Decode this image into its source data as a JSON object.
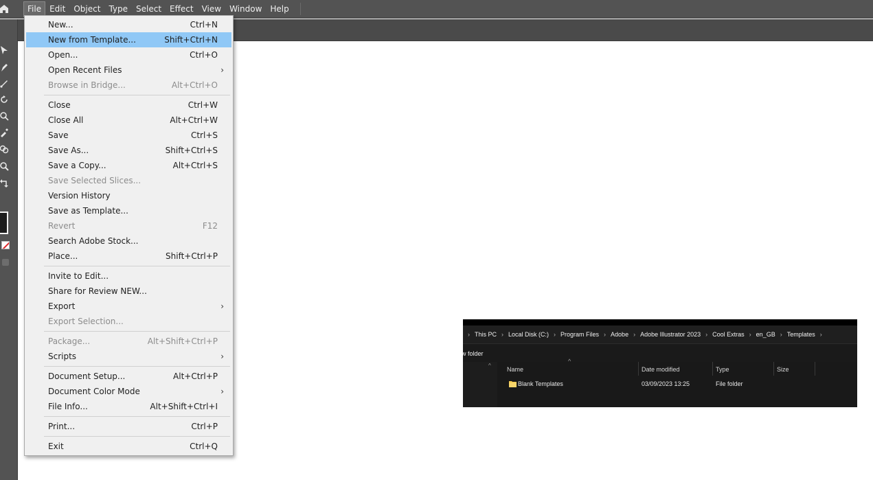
{
  "menubar": {
    "items": [
      "File",
      "Edit",
      "Object",
      "Type",
      "Select",
      "Effect",
      "View",
      "Window",
      "Help"
    ],
    "open_item": "File"
  },
  "file_menu": {
    "highlighted": "New from Template...",
    "items": [
      {
        "label": "New...",
        "shortcut": "Ctrl+N"
      },
      {
        "label": "New from Template...",
        "shortcut": "Shift+Ctrl+N"
      },
      {
        "label": "Open...",
        "shortcut": "Ctrl+O"
      },
      {
        "label": "Open Recent Files",
        "shortcut": "",
        "submenu": true
      },
      {
        "label": "Browse in Bridge...",
        "shortcut": "Alt+Ctrl+O",
        "disabled": true
      },
      {
        "label": "Close",
        "shortcut": "Ctrl+W"
      },
      {
        "label": "Close All",
        "shortcut": "Alt+Ctrl+W"
      },
      {
        "label": "Save",
        "shortcut": "Ctrl+S"
      },
      {
        "label": "Save As...",
        "shortcut": "Shift+Ctrl+S"
      },
      {
        "label": "Save a Copy...",
        "shortcut": "Alt+Ctrl+S"
      },
      {
        "label": "Save Selected Slices...",
        "shortcut": "",
        "disabled": true
      },
      {
        "label": "Version History",
        "shortcut": ""
      },
      {
        "label": "Save as Template...",
        "shortcut": ""
      },
      {
        "label": "Revert",
        "shortcut": "F12",
        "disabled": true
      },
      {
        "label": "Search Adobe Stock...",
        "shortcut": ""
      },
      {
        "label": "Place...",
        "shortcut": "Shift+Ctrl+P"
      },
      {
        "label": "Invite to Edit...",
        "shortcut": ""
      },
      {
        "label": "Share for Review NEW...",
        "shortcut": ""
      },
      {
        "label": "Export",
        "shortcut": "",
        "submenu": true
      },
      {
        "label": "Export Selection...",
        "shortcut": "",
        "disabled": true
      },
      {
        "label": "Package...",
        "shortcut": "Alt+Shift+Ctrl+P",
        "disabled": true
      },
      {
        "label": "Scripts",
        "shortcut": "",
        "submenu": true
      },
      {
        "label": "Document Setup...",
        "shortcut": "Alt+Ctrl+P"
      },
      {
        "label": "Document Color Mode",
        "shortcut": "",
        "submenu": true
      },
      {
        "label": "File Info...",
        "shortcut": "Alt+Shift+Ctrl+I"
      },
      {
        "label": "Print...",
        "shortcut": "Ctrl+P"
      },
      {
        "label": "Exit",
        "shortcut": "Ctrl+Q"
      }
    ]
  },
  "explorer": {
    "breadcrumb": [
      "This PC",
      "Local Disk (C:)",
      "Program Files",
      "Adobe",
      "Adobe Illustrator 2023",
      "Cool Extras",
      "en_GB",
      "Templates"
    ],
    "toolbar_text": "w folder",
    "columns": [
      "Name",
      "Date modified",
      "Type",
      "Size"
    ],
    "rows": [
      {
        "name": "Blank Templates",
        "date_modified": "03/09/2023 13:25",
        "type": "File folder",
        "size": ""
      }
    ]
  },
  "colors": {
    "menubar_bg": "#535353",
    "menu_highlight": "#90c8f6",
    "dropdown_bg": "#f0f0f0",
    "explorer_bg": "#191919",
    "folder_icon": "#f4c84a"
  }
}
